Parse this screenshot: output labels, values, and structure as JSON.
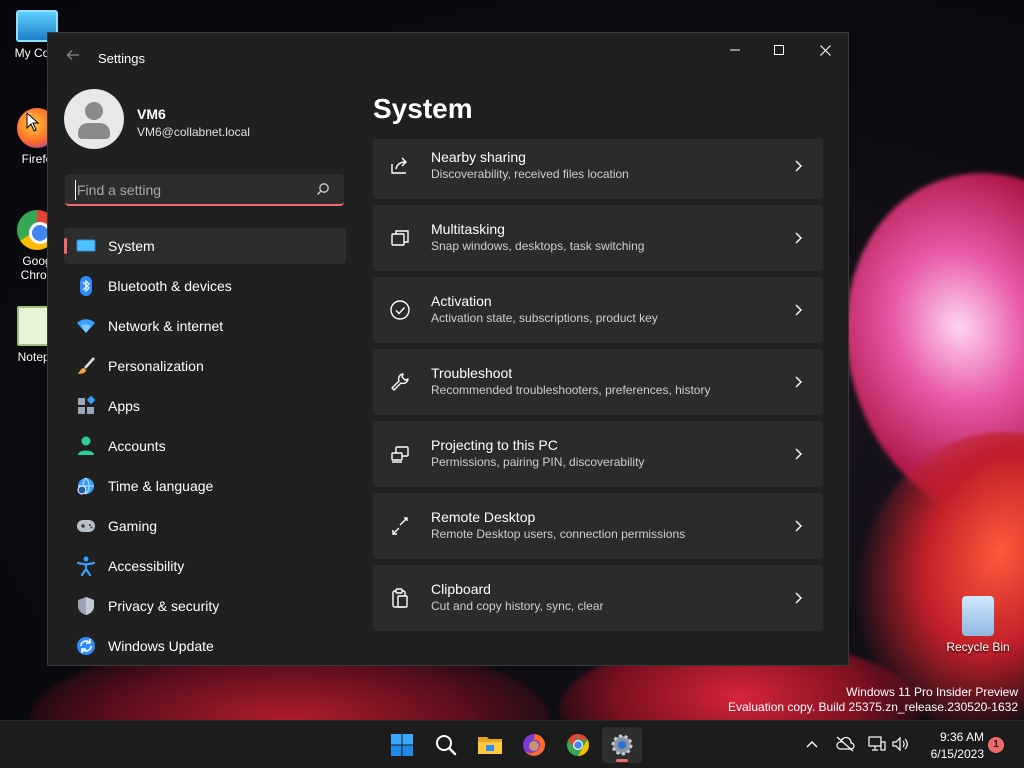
{
  "desktop": {
    "icons": [
      {
        "label": "My Com"
      },
      {
        "label": "Firefo"
      },
      {
        "label": "Goog\nChron"
      },
      {
        "label": "Notepa"
      },
      {
        "label": "Recycle Bin"
      }
    ],
    "watermark": {
      "line1": "Windows 11 Pro Insider Preview",
      "line2": "Evaluation copy. Build 25375.zn_release.230520-1632"
    }
  },
  "window": {
    "title": "Settings",
    "back_icon": "back-arrow-icon"
  },
  "profile": {
    "name": "VM6",
    "email": "VM6@collabnet.local"
  },
  "search": {
    "placeholder": "Find a setting",
    "value": ""
  },
  "accent_color": "#ef6b6b",
  "nav": {
    "items": [
      {
        "label": "System",
        "icon": "monitor-icon",
        "active": true
      },
      {
        "label": "Bluetooth & devices",
        "icon": "bluetooth-icon"
      },
      {
        "label": "Network & internet",
        "icon": "wifi-icon"
      },
      {
        "label": "Personalization",
        "icon": "brush-icon"
      },
      {
        "label": "Apps",
        "icon": "apps-icon"
      },
      {
        "label": "Accounts",
        "icon": "person-icon"
      },
      {
        "label": "Time & language",
        "icon": "globe-clock-icon"
      },
      {
        "label": "Gaming",
        "icon": "gamepad-icon"
      },
      {
        "label": "Accessibility",
        "icon": "accessibility-icon"
      },
      {
        "label": "Privacy & security",
        "icon": "shield-icon"
      },
      {
        "label": "Windows Update",
        "icon": "update-icon"
      }
    ]
  },
  "main": {
    "title": "System",
    "cards": [
      {
        "title": "Nearby sharing",
        "subtitle": "Discoverability, received files location",
        "icon": "share-icon"
      },
      {
        "title": "Multitasking",
        "subtitle": "Snap windows, desktops, task switching",
        "icon": "multitasking-icon"
      },
      {
        "title": "Activation",
        "subtitle": "Activation state, subscriptions, product key",
        "icon": "check-circle-icon"
      },
      {
        "title": "Troubleshoot",
        "subtitle": "Recommended troubleshooters, preferences, history",
        "icon": "wrench-icon"
      },
      {
        "title": "Projecting to this PC",
        "subtitle": "Permissions, pairing PIN, discoverability",
        "icon": "projector-icon"
      },
      {
        "title": "Remote Desktop",
        "subtitle": "Remote Desktop users, connection permissions",
        "icon": "remote-desktop-icon"
      },
      {
        "title": "Clipboard",
        "subtitle": "Cut and copy history, sync, clear",
        "icon": "clipboard-icon"
      }
    ]
  },
  "taskbar": {
    "apps": [
      "start-icon",
      "search-icon",
      "file-explorer-icon",
      "firefox-icon",
      "chrome-icon",
      "settings-icon"
    ],
    "clock": {
      "time": "9:36 AM",
      "date": "6/15/2023"
    },
    "notification_count": "1"
  }
}
